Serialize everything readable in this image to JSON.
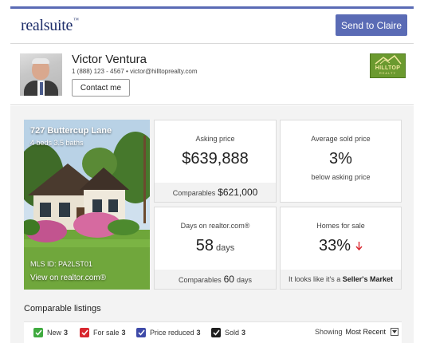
{
  "brand": {
    "logo_text": "realsuite",
    "logo_mark": "™"
  },
  "header": {
    "send_label": "Send to Claire"
  },
  "agent": {
    "name": "Victor Ventura",
    "contact_line": "1 (888) 123 - 4567  •  victor@hilltoprealty.com",
    "contact_button": "Contact me",
    "brokerage_name": "HILLTOP",
    "brokerage_sub": "REALTY"
  },
  "listing": {
    "address": "727 Buttercup Lane",
    "beds_baths": "4 beds 3.5 baths",
    "mls": "MLS ID: PA2LST01",
    "link_text": "View on realtor.com®"
  },
  "stats": {
    "asking": {
      "label": "Asking price",
      "value": "$639,888",
      "foot_label": "Comparables",
      "foot_value": "$621,000"
    },
    "avg_sold": {
      "label": "Average sold price",
      "value": "3%",
      "sub": "below asking price"
    },
    "days": {
      "label": "Days on realtor.com®",
      "value": "58",
      "unit": "days",
      "foot_label": "Comparables",
      "foot_value": "60",
      "foot_unit": "days"
    },
    "homes": {
      "label": "Homes for sale",
      "value": "33%",
      "foot_text": "It looks like it's a",
      "foot_bold": "Seller's Market"
    }
  },
  "comparables": {
    "title": "Comparable listings",
    "filters": [
      {
        "label": "New",
        "count": "3",
        "color": "#3faa3f"
      },
      {
        "label": "For sale",
        "count": "3",
        "color": "#d8262e"
      },
      {
        "label": "Price reduced",
        "count": "3",
        "color": "#3e4aa8"
      },
      {
        "label": "Sold",
        "count": "3",
        "color": "#1f1f1f"
      }
    ],
    "showing_label": "Showing",
    "showing_value": "Most Recent"
  },
  "colors": {
    "accent": "#5a6bb5",
    "down_arrow": "#d8262e"
  },
  "icons": {
    "down_arrow": "arrow-down-icon",
    "dropdown": "chevron-down-icon",
    "checkbox": "checkbox-checked-icon"
  }
}
